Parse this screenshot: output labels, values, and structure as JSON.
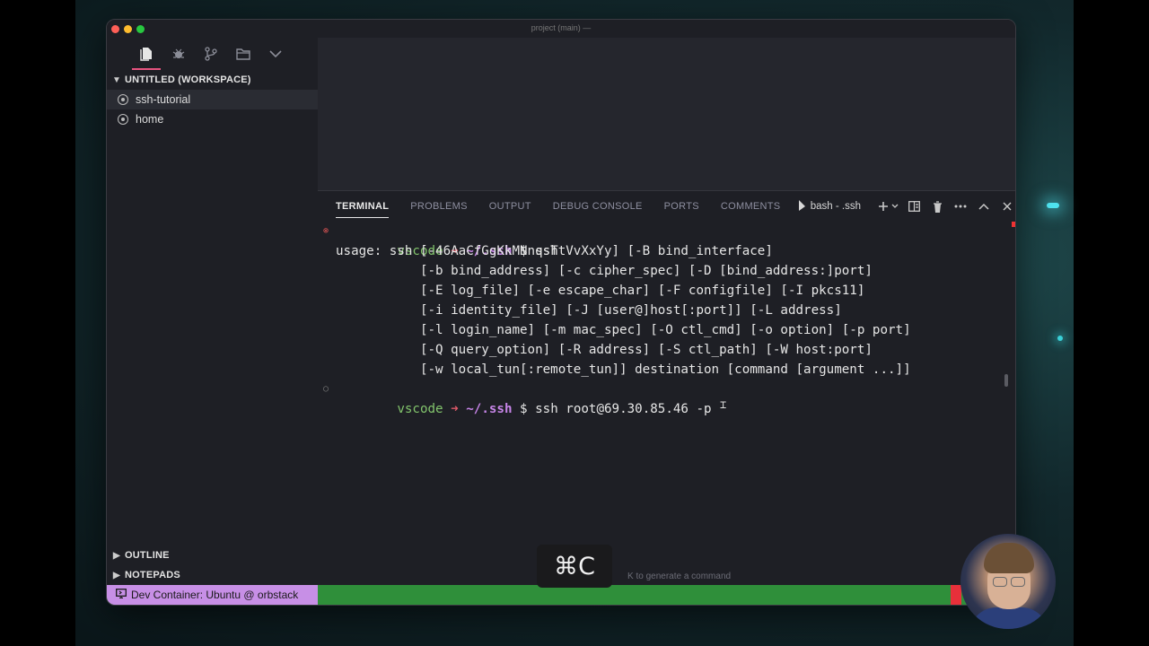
{
  "window": {
    "title": "project (main) —"
  },
  "activity_bar": {
    "icons": [
      "files-icon",
      "debug-icon",
      "source-control-icon",
      "folder-icon",
      "chevron-down-icon"
    ]
  },
  "workspace": {
    "header": "UNTITLED (WORKSPACE)",
    "items": [
      {
        "label": "ssh-tutorial",
        "selected": true
      },
      {
        "label": "home",
        "selected": false
      }
    ]
  },
  "sidebar_sections": {
    "outline": "OUTLINE",
    "notepads": "NOTEPADS"
  },
  "panel": {
    "tabs": [
      "TERMINAL",
      "PROBLEMS",
      "OUTPUT",
      "DEBUG CONSOLE",
      "PORTS",
      "COMMENTS"
    ],
    "active_tab": "TERMINAL",
    "terminal_name": "bash - .ssh"
  },
  "terminal": {
    "prompt_user": "vscode",
    "prompt_arrow": "➜",
    "prompt_path": "~/.ssh",
    "prompt_dollar": "$",
    "command1": "ssh",
    "usage_lines": [
      "usage: ssh [-46AaCfGgKkMNnqsTtVvXxYy] [-B bind_interface]",
      "           [-b bind_address] [-c cipher_spec] [-D [bind_address:]port]",
      "           [-E log_file] [-e escape_char] [-F configfile] [-I pkcs11]",
      "           [-i identity_file] [-J [user@]host[:port]] [-L address]",
      "           [-l login_name] [-m mac_spec] [-O ctl_cmd] [-o option] [-p port]",
      "           [-Q query_option] [-R address] [-S ctl_path] [-W host:port]",
      "           [-w local_tun[:remote_tun]] destination [command [argument ...]]"
    ],
    "command2": "ssh root@69.30.85.46 -p"
  },
  "hint_text": "K to generate a command",
  "statusbar": {
    "remote": "Dev Container: Ubuntu @ orbstack"
  },
  "keycap": "⌘C",
  "colors": {
    "status_green": "#2f8f3a",
    "remote_purple": "#c78fe6",
    "prompt_green": "#82c46c",
    "prompt_path": "#c785e8",
    "error_red": "#e05555"
  }
}
